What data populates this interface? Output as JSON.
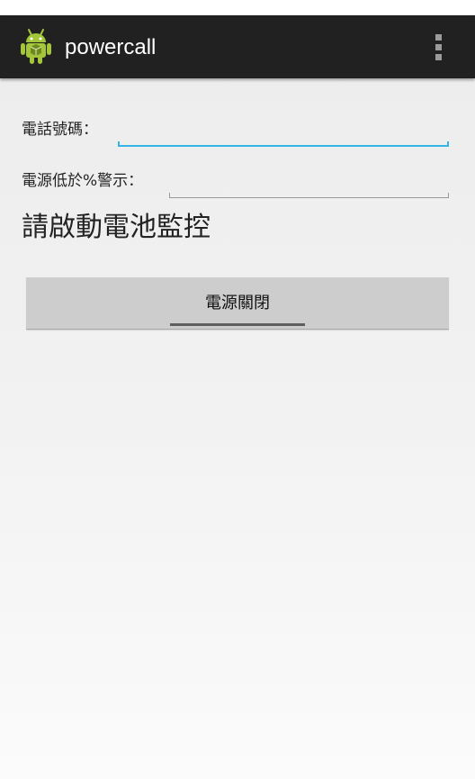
{
  "app": {
    "title": "powercall",
    "icon": "android-robot-icon",
    "overflow_icon": "more-vert-icon"
  },
  "form": {
    "phone_label": "電話號碼：",
    "phone_value": "",
    "battery_label": "電源低於%警示：",
    "battery_value": ""
  },
  "status": {
    "monitor_text": "請啟動電池監控"
  },
  "power_button": {
    "label": "電源關閉"
  },
  "colors": {
    "action_bar": "#212121",
    "focus_accent": "#33b5e5",
    "button_bg": "#cdcdcd",
    "android_green": "#a4c639"
  }
}
